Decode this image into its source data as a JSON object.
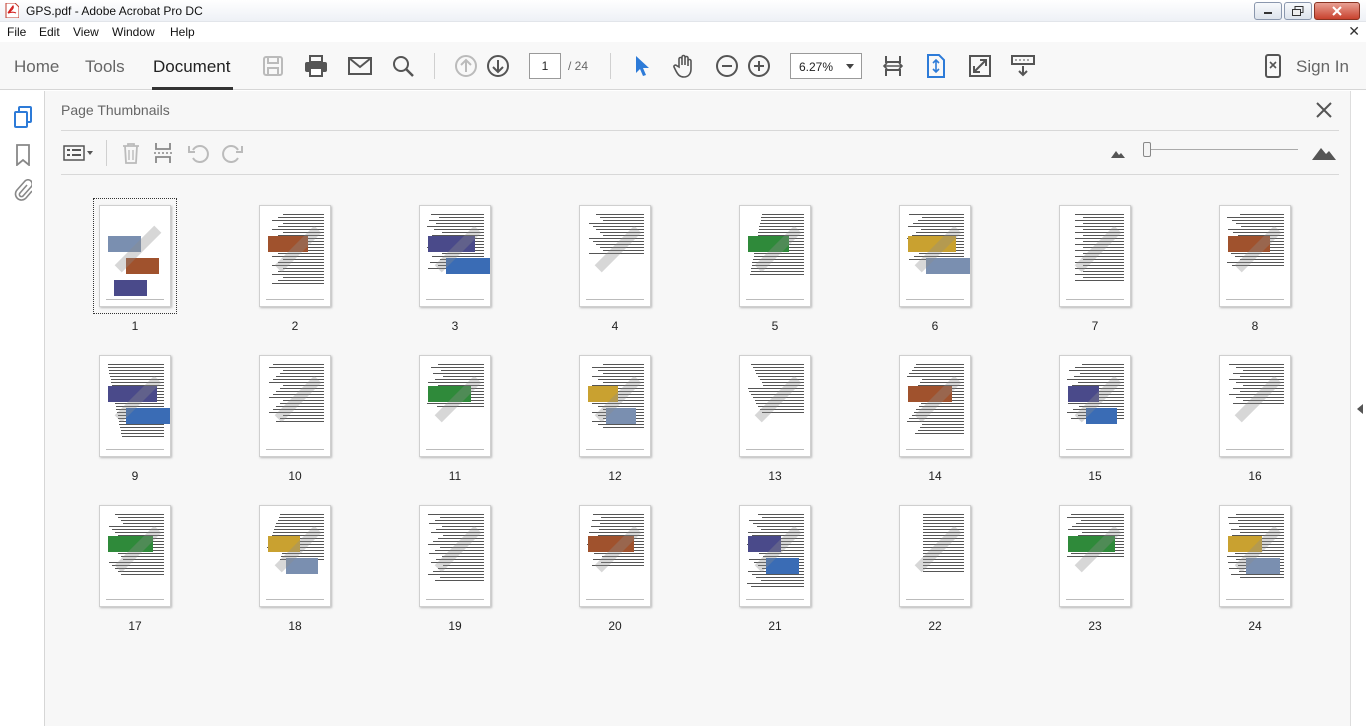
{
  "window": {
    "title": "GPS.pdf - Adobe Acrobat Pro DC"
  },
  "menu": {
    "items": [
      "File",
      "Edit",
      "View",
      "Window",
      "Help"
    ]
  },
  "toolbar": {
    "tabs": [
      "Home",
      "Tools",
      "Document"
    ],
    "active_tab": "Document",
    "page_current": "1",
    "page_total": "/ 24",
    "zoom": "6.27%",
    "sign_in": "Sign In"
  },
  "panel": {
    "title": "Page Thumbnails"
  },
  "thumbnails": {
    "selected": "1",
    "pages": [
      "1",
      "2",
      "3",
      "4",
      "5",
      "6",
      "7",
      "8",
      "9",
      "10",
      "11",
      "12",
      "13",
      "14",
      "15",
      "16",
      "17",
      "18",
      "19",
      "20",
      "21",
      "22",
      "23",
      "24"
    ]
  },
  "colors": {
    "accent": "#2d7bd8",
    "toolbar_bg": "#f8f8f8",
    "panel_bg": "#f7f7f7"
  }
}
